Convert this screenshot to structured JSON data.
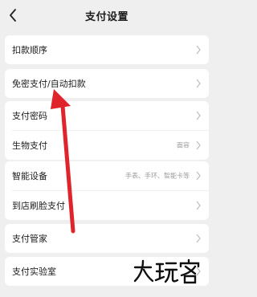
{
  "header": {
    "title": "支付设置"
  },
  "icons": {
    "back": "back-chevron-icon",
    "row_chevron": "chevron-right-icon"
  },
  "groups": [
    {
      "rows": [
        {
          "label": "扣款顺序",
          "value": ""
        }
      ]
    },
    {
      "rows": [
        {
          "label": "免密支付/自动扣款",
          "value": ""
        }
      ]
    },
    {
      "rows": [
        {
          "label": "支付密码",
          "value": ""
        },
        {
          "label": "生物支付",
          "value": "面容"
        }
      ]
    },
    {
      "rows": [
        {
          "label": "智能设备",
          "value": "手表、手环、智能卡等"
        },
        {
          "label": "到店刷脸支付",
          "value": ""
        }
      ]
    },
    {
      "rows": [
        {
          "label": "支付管家",
          "value": ""
        }
      ]
    },
    {
      "rows": [
        {
          "label": "支付实验室",
          "value": ""
        }
      ]
    }
  ],
  "watermark": {
    "text": "大玩家"
  },
  "colors": {
    "annotation_arrow": "#e0242b",
    "background": "#efefef",
    "card": "#ffffff"
  }
}
